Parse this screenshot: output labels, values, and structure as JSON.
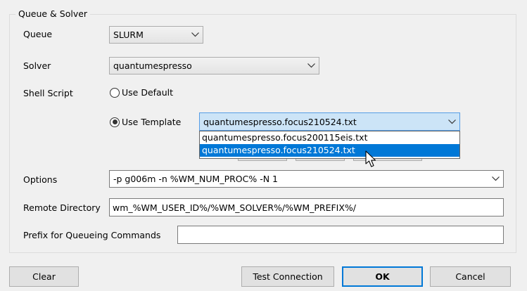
{
  "group": {
    "legend": "Queue & Solver"
  },
  "queue": {
    "label": "Queue",
    "value": "SLURM"
  },
  "solver": {
    "label": "Solver",
    "value": "quantumespresso"
  },
  "shell_script": {
    "label": "Shell Script",
    "use_default_label": "Use Default",
    "use_default_selected": false,
    "use_template_label": "Use Template",
    "use_template_selected": true,
    "template_value": "quantumespresso.focus210524.txt",
    "template_options": [
      "quantumespresso.focus200115eis.txt",
      "quantumespresso.focus210524.txt"
    ],
    "highlighted_option": "quantumespresso.focus210524.txt"
  },
  "options": {
    "label": "Options",
    "value": "-p g006m -n %WM_NUM_PROC% -N 1"
  },
  "remote_directory": {
    "label": "Remote Directory",
    "value": "wm_%WM_USER_ID%/%WM_SOLVER%/%WM_PREFIX%/"
  },
  "prefix": {
    "label": "Prefix for Queueing Commands",
    "value": ""
  },
  "buttons": {
    "clear": "Clear",
    "test_connection": "Test Connection",
    "ok": "OK",
    "cancel": "Cancel"
  },
  "colors": {
    "selection_blue": "#0078d7",
    "combo_selected_bg": "#cce4f7"
  },
  "icons": {
    "dropdown": "chevron-down-icon",
    "cursor": "mouse-pointer-icon"
  }
}
